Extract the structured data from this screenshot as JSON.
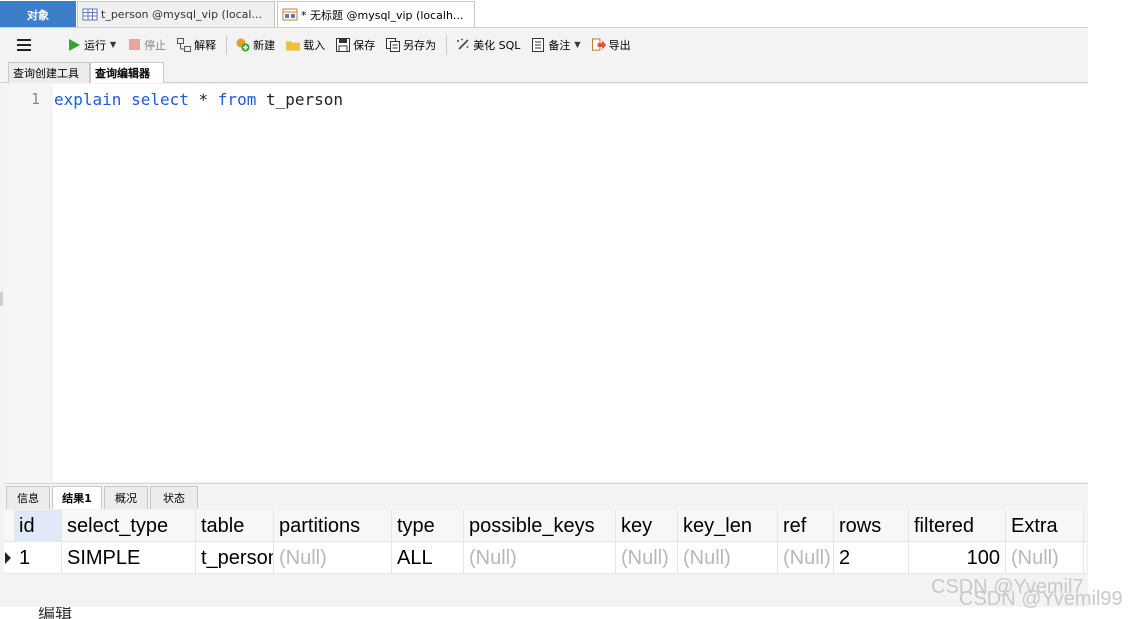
{
  "tabs": {
    "objects": "对象",
    "t_person": "t_person @mysql_vip (local...",
    "untitled": "* 无标题 @mysql_vip (localh..."
  },
  "toolbar": {
    "menu_icon": "menu-icon",
    "run": "运行",
    "stop": "停止",
    "explain": "解释",
    "new": "新建",
    "load": "载入",
    "save": "保存",
    "save_as": "另存为",
    "beautify": "美化 SQL",
    "notes": "备注",
    "export": "导出"
  },
  "subtabs": {
    "query_builder": "查询创建工具",
    "query_editor": "查询编辑器"
  },
  "editor": {
    "line_number": "1",
    "tokens": {
      "explain": "explain",
      "select": "select",
      "star": "*",
      "from": "from",
      "table": "t_person"
    }
  },
  "result_tabs": {
    "info": "信息",
    "result1": "结果1",
    "profile": "概况",
    "status": "状态"
  },
  "grid": {
    "columns": [
      "id",
      "select_type",
      "table",
      "partitions",
      "type",
      "possible_keys",
      "key",
      "key_len",
      "ref",
      "rows",
      "filtered",
      "Extra"
    ],
    "rows": [
      [
        "1",
        "SIMPLE",
        "t_person",
        "(Null)",
        "ALL",
        "(Null)",
        "(Null)",
        "(Null)",
        "(Null)",
        "2",
        "100",
        "(Null)"
      ]
    ]
  },
  "bottom_text": "编辑",
  "watermark": {
    "line1": "CSDN @Yvemil7",
    "line2": "CSDN @Yvemil99"
  },
  "colors": {
    "accent_tab": "#3d7ec8",
    "keyword": "#1c5ae0",
    "null_text": "#b8b8b8"
  }
}
